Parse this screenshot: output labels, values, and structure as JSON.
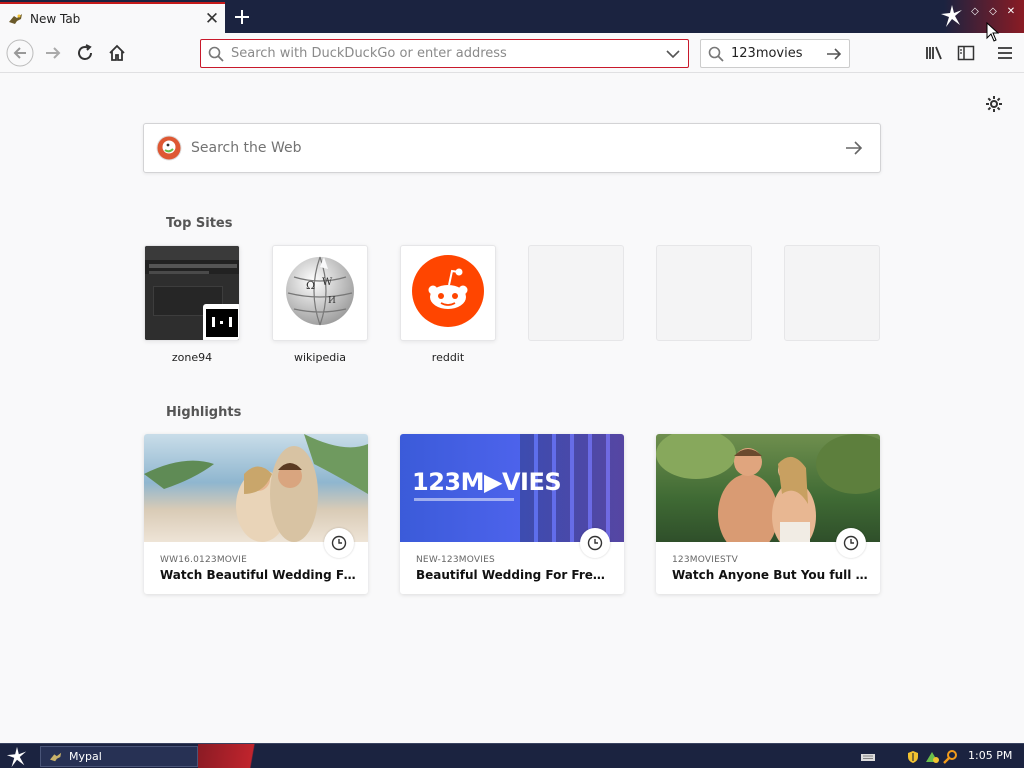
{
  "browser": {
    "tab": {
      "title": "New Tab"
    },
    "urlbar": {
      "placeholder": "Search with DuckDuckGo or enter address"
    },
    "searchbar": {
      "value": "123movies"
    }
  },
  "newtab": {
    "websearch_placeholder": "Search the Web",
    "top_sites_title": "Top Sites",
    "highlights_title": "Highlights",
    "top_sites": [
      {
        "label": "zone94"
      },
      {
        "label": "wikipedia"
      },
      {
        "label": "reddit"
      },
      {
        "label": ""
      },
      {
        "label": ""
      },
      {
        "label": ""
      }
    ],
    "highlights": [
      {
        "source": "WW16.0123MOVIE",
        "title": "Watch Beautiful Wedding For Fr..."
      },
      {
        "source": "NEW-123MOVIES",
        "title": "Beautiful Wedding For Free with...",
        "image_text": "123M▶VIES"
      },
      {
        "source": "123MOVIESTV",
        "title": "Watch Anyone But You full movi..."
      }
    ]
  },
  "taskbar": {
    "task_label": "Mypal",
    "clock": "1:05 PM"
  },
  "colors": {
    "accent": "#c8192b",
    "reddit": "#ff4500",
    "ddg": "#de5833",
    "titlebar": "#1b2340",
    "movies_banner": "#4a58e8"
  }
}
